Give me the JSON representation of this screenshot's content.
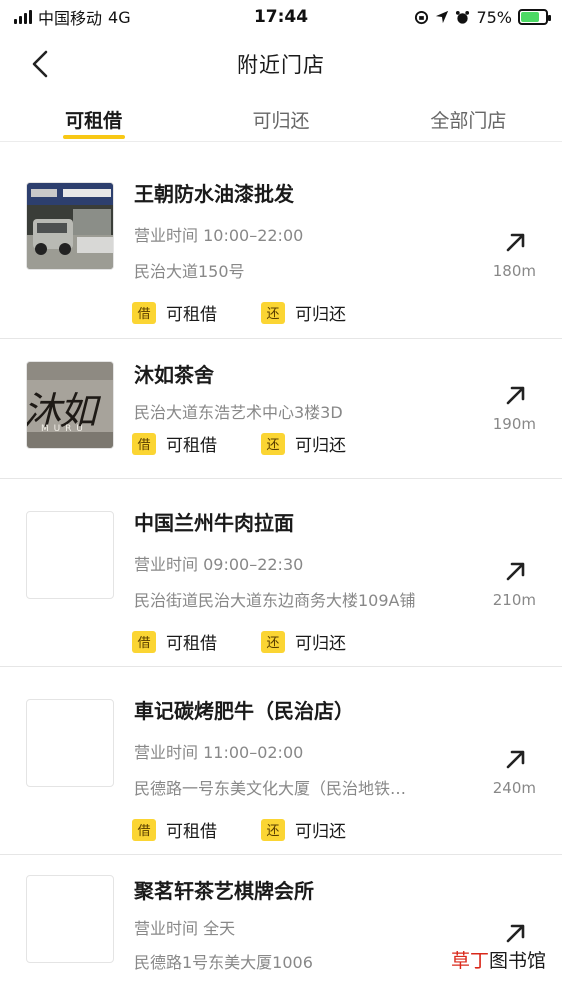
{
  "status_bar": {
    "carrier": "中国移动",
    "network": "4G",
    "time": "17:44",
    "battery_percent": "75%",
    "battery_level": 0.75
  },
  "header": {
    "title": "附近门店"
  },
  "tabs": [
    {
      "label": "可租借",
      "active": true
    },
    {
      "label": "可归还",
      "active": false
    },
    {
      "label": "全部门店",
      "active": false
    }
  ],
  "badge_labels": {
    "borrow_icon": "借",
    "borrow_text": "可租借",
    "return_icon": "还",
    "return_text": "可归还"
  },
  "stores": [
    {
      "name": "王朝防水油漆批发",
      "hours": "营业时间 10:00–22:00",
      "address": "民治大道150号",
      "distance": "180m",
      "thumb": "storefront-photo"
    },
    {
      "name": "沐如茶舍",
      "address": "民治大道东浩艺术中心3楼3D",
      "distance": "190m",
      "thumb": "tea-house-logo",
      "logo_text": "沐如",
      "logo_sub": "M U R U"
    },
    {
      "name": "中国兰州牛肉拉面",
      "hours": "营业时间 09:00–22:30",
      "address": "民治街道民治大道东边商务大楼109A铺",
      "distance": "210m",
      "thumb": "empty"
    },
    {
      "name": "車记碳烤肥牛（民治店）",
      "hours": "营业时间 11:00–02:00",
      "address": "民德路一号东美文化大厦（民治地铁…",
      "distance": "240m",
      "thumb": "empty"
    },
    {
      "name": "聚茗轩茶艺棋牌会所",
      "hours": "营业时间 全天",
      "address": "民德路1号东美大厦1006",
      "thumb": "empty"
    }
  ],
  "watermark": {
    "part1": "草丁",
    "part2": "图书馆"
  },
  "colors": {
    "accent": "#f8c815",
    "badge": "#fbd533",
    "watermark_red": "#d9281a"
  }
}
